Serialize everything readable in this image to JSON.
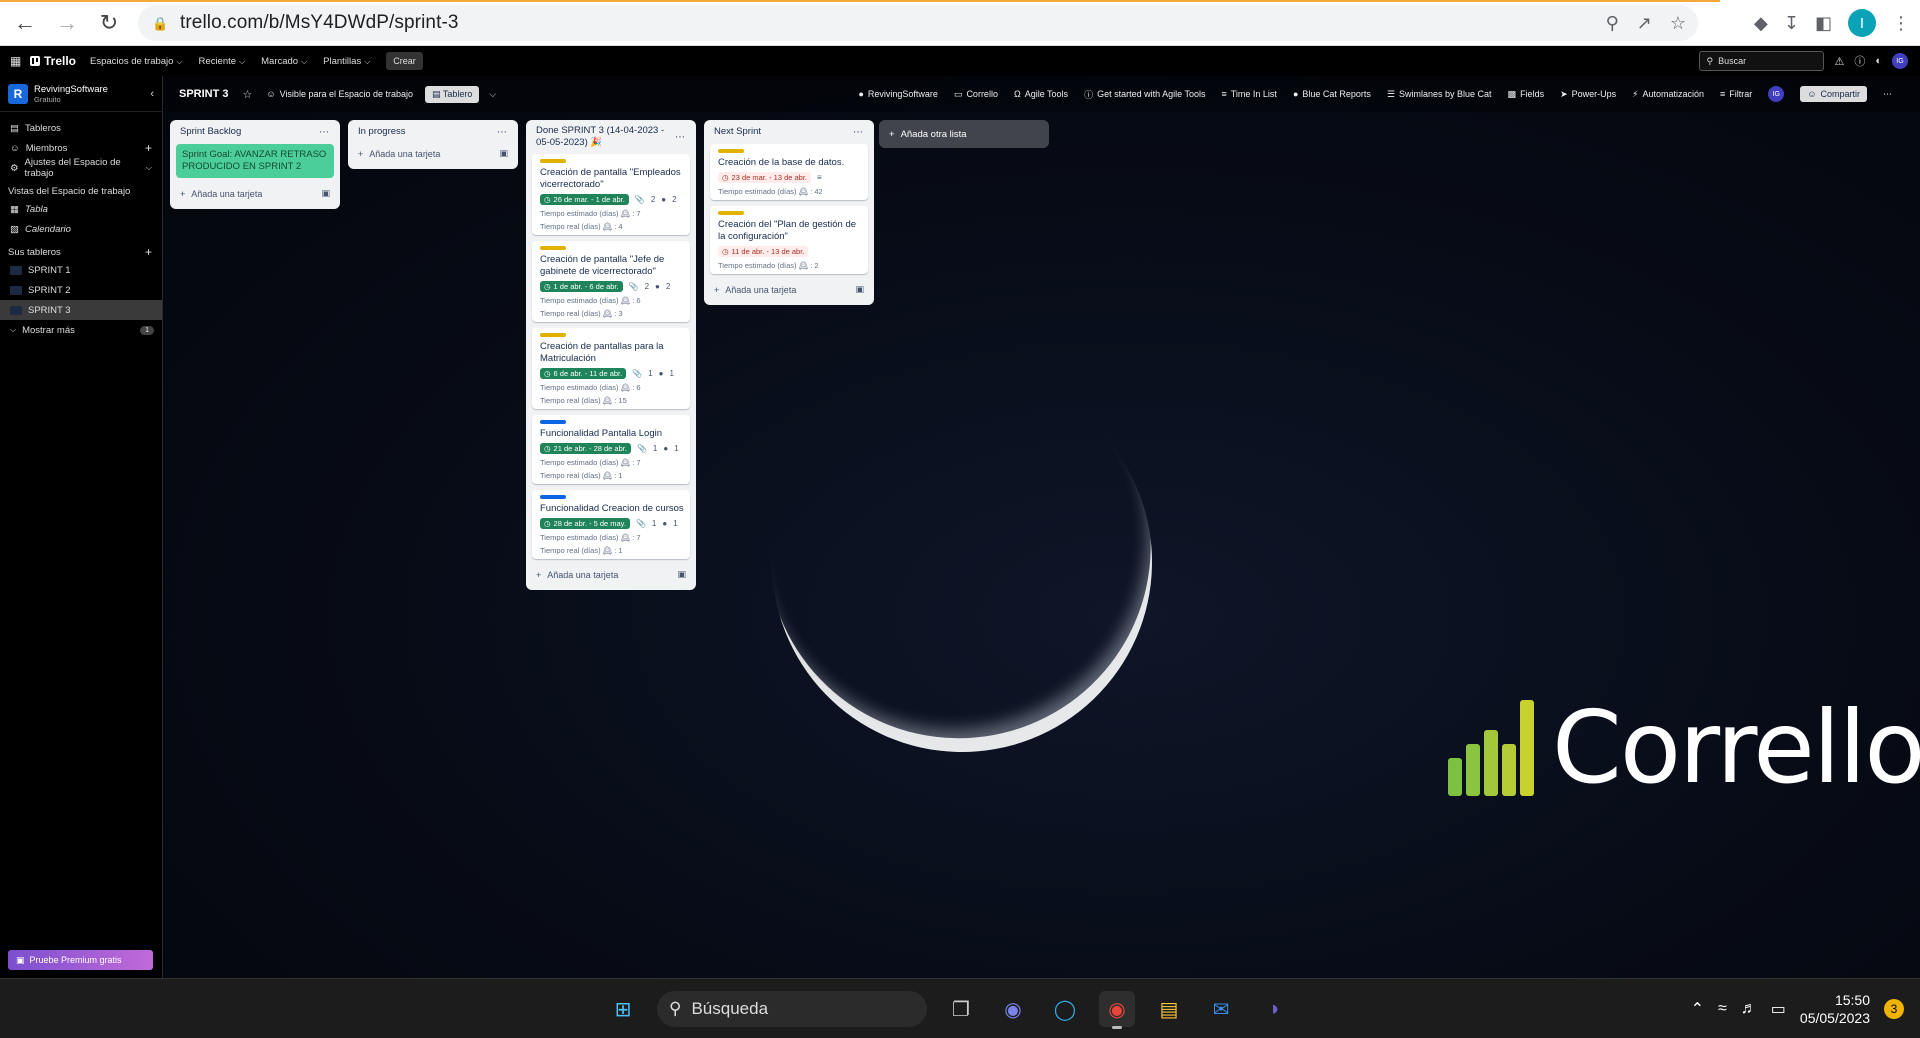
{
  "browser": {
    "url": "trello.com/b/MsY4DWdP/sprint-3",
    "profile_initial": "I"
  },
  "header": {
    "logo": "Trello",
    "nav": [
      "Espacios de trabajo",
      "Reciente",
      "Marcado",
      "Plantillas"
    ],
    "create": "Crear",
    "search_placeholder": "Buscar",
    "avatar": "IG"
  },
  "sidebar": {
    "workspace_name": "RevivingSoftware",
    "workspace_plan": "Gratuito",
    "items": [
      "Tableros",
      "Miembros",
      "Ajustes del Espacio de trabajo"
    ],
    "views_title": "Vistas del Espacio de trabajo",
    "views": [
      "Tabla",
      "Calendario"
    ],
    "boards_title": "Sus tableros",
    "boards": [
      "SPRINT 1",
      "SPRINT 2",
      "SPRINT 3"
    ],
    "show_more": "Mostrar más",
    "show_more_count": "1",
    "premium": "Pruebe Premium gratis"
  },
  "board": {
    "title": "SPRINT 3",
    "visibility": "Visible para el Espacio de trabajo",
    "view": "Tablero",
    "toolbar": [
      "RevivingSoftware",
      "Corrello",
      "Agile Tools",
      "Get started with Agile Tools",
      "Time In List",
      "Blue Cat Reports",
      "Swimlanes by Blue Cat",
      "Fields",
      "Power-Ups",
      "Automatización",
      "Filtrar"
    ],
    "share": "Compartir",
    "add_list": "Añada otra lista",
    "add_card": "Añada una tarjeta"
  },
  "lists": {
    "backlog": {
      "title": "Sprint Backlog",
      "goal": "Sprint Goal: AVANZAR RETRASO PRODUCIDO EN SPRINT 2"
    },
    "progress": {
      "title": "In progress"
    },
    "done": {
      "title": "Done SPRINT 3 (14-04-2023 - 05-05-2023) 🎉",
      "cards": [
        {
          "title": "Creación de pantalla \"Empleados vicerrectorado\"",
          "date": "26 de mar. - 1 de abr.",
          "attach": "2",
          "gh": "2",
          "est": "Tiempo estimado (días) 🕰 : 7",
          "real": "Tiempo real (días) 🕰 : 4"
        },
        {
          "title": "Creación de pantalla \"Jefe de gabinete de vicerrectorado\"",
          "date": "1 de abr. - 6 de abr.",
          "attach": "2",
          "gh": "2",
          "est": "Tiempo estimado (días) 🕰 : 6",
          "real": "Tiempo real (días) 🕰 : 3"
        },
        {
          "title": "Creación de pantallas para la Matriculación",
          "date": "6 de abr. - 11 de abr.",
          "attach": "1",
          "gh": "1",
          "est": "Tiempo estimado (días) 🕰 : 6",
          "real": "Tiempo real (días) 🕰 : 15"
        },
        {
          "title": "Funcionalidad Pantalla Login",
          "date": "21 de abr. - 28 de abr.",
          "attach": "1",
          "gh": "1",
          "est": "Tiempo estimado (días) 🕰 : 7",
          "real": "Tiempo real (días) 🕰 : 1"
        },
        {
          "title": "Funcionalidad Creacion de cursos",
          "date": "28 de abr. - 5 de may.",
          "attach": "1",
          "gh": "1",
          "est": "Tiempo estimado (días) 🕰 : 7",
          "real": "Tiempo real (días) 🕰 : 1"
        }
      ]
    },
    "next": {
      "title": "Next Sprint",
      "cards": [
        {
          "title": "Creación de la base de datos.",
          "date": "23 de mar. - 13 de abr.",
          "est": "Tiempo estimado (días) 🕰 : 42"
        },
        {
          "title": "Creación del \"Plan de gestión de la configuración\"",
          "date": "11 de abr. - 13 de abr.",
          "est": "Tiempo estimado (días) 🕰 : 2"
        }
      ]
    }
  },
  "watermark": "Corrello",
  "taskbar": {
    "search": "Búsqueda",
    "time": "15:50",
    "date": "05/05/2023",
    "notifications": "3"
  },
  "colors": {
    "label_yellow": "#e2b203",
    "label_blue": "#0c66e4",
    "goal_green": "#4bce97",
    "date_green": "#1f845a"
  }
}
